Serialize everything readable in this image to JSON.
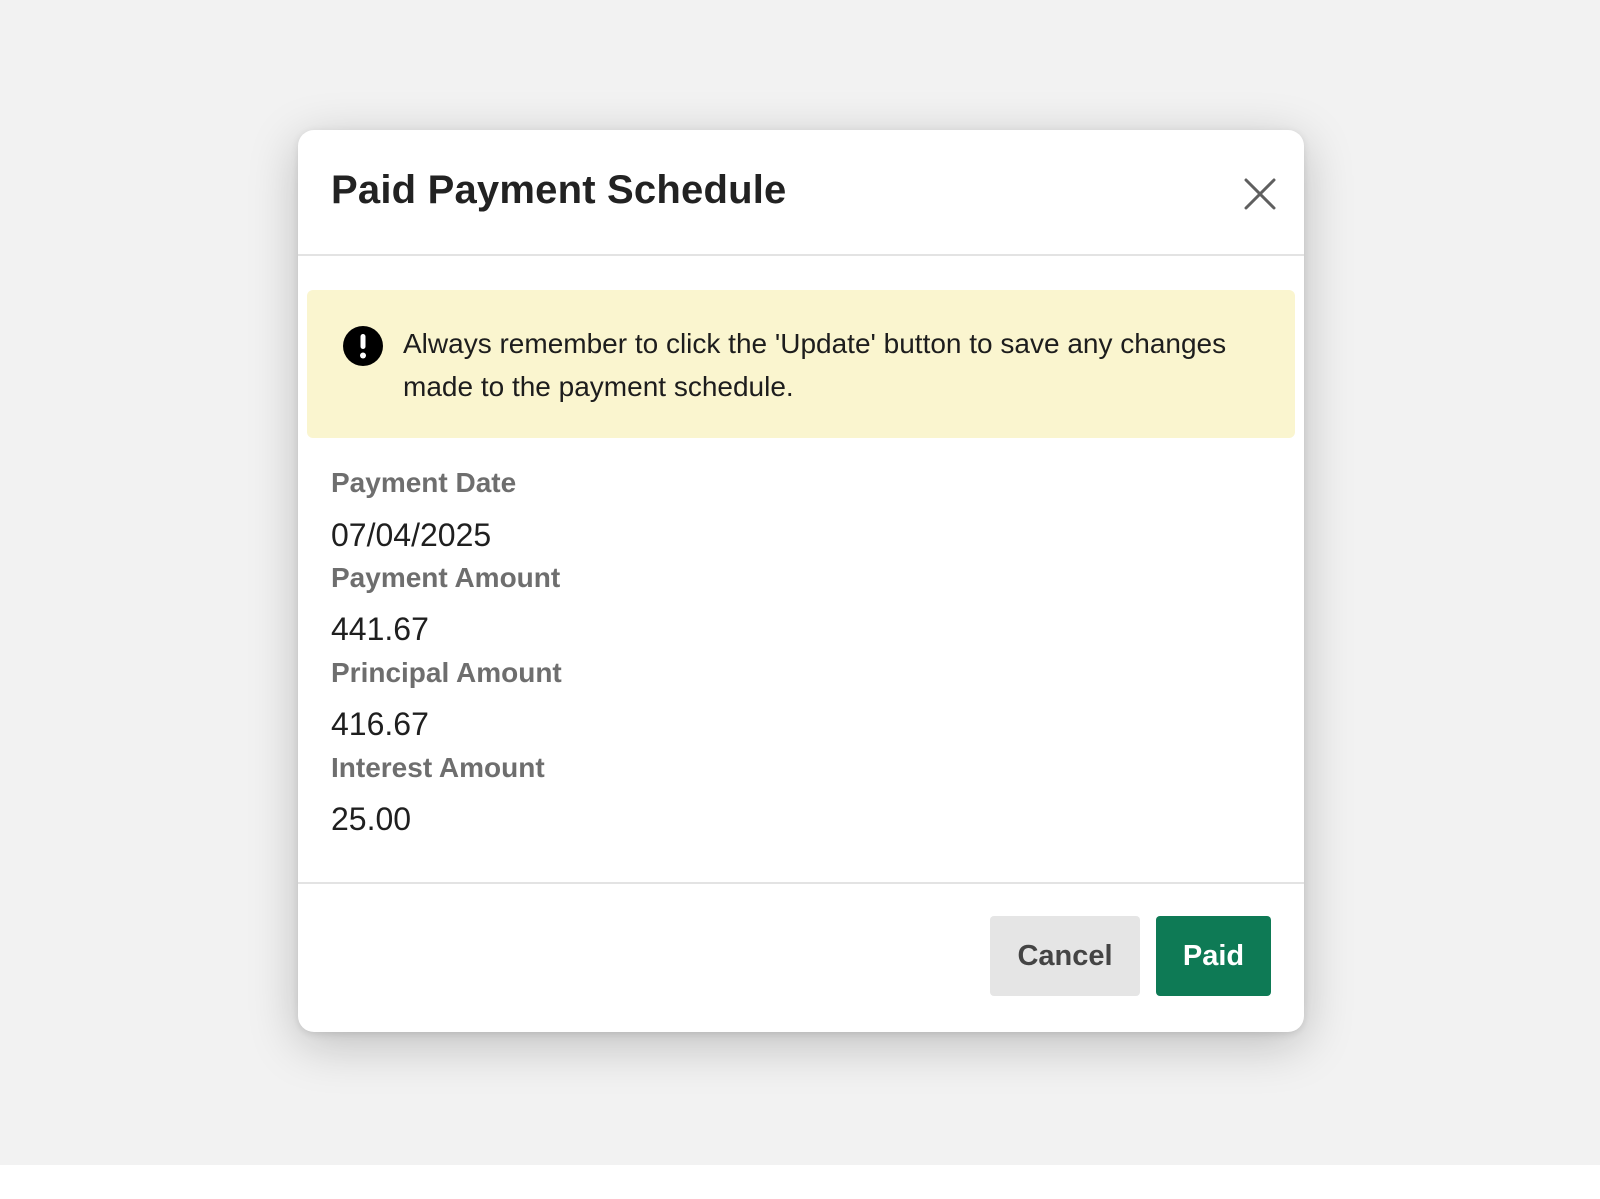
{
  "modal": {
    "title": "Paid Payment Schedule",
    "close_icon": "close-icon"
  },
  "alert": {
    "icon": "exclamation-circle-icon",
    "message": "Always remember to click the 'Update' button to save any changes made to the payment schedule."
  },
  "fields": {
    "payment_date": {
      "label": "Payment Date",
      "value": "07/04/2025"
    },
    "payment_amount": {
      "label": "Payment Amount",
      "value": "441.67"
    },
    "principal_amount": {
      "label": "Principal Amount",
      "value": "416.67"
    },
    "interest_amount": {
      "label": "Interest Amount",
      "value": "25.00"
    }
  },
  "footer": {
    "cancel_label": "Cancel",
    "paid_label": "Paid"
  },
  "colors": {
    "primary": "#0e7a55",
    "alert_background": "#faf5cf",
    "backdrop": "#f2f2f2"
  }
}
